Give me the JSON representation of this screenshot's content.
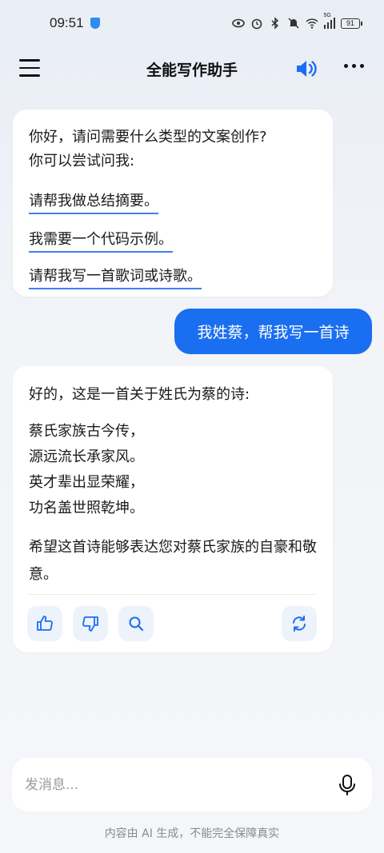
{
  "status": {
    "time": "09:51",
    "signal": "5G",
    "battery": "91"
  },
  "header": {
    "title": "全能写作助手",
    "menu_icon": "hamburger-menu-icon",
    "speaker_icon": "speaker-icon",
    "more_icon": "more-dots-icon",
    "accent": "#1a6ef0"
  },
  "messages": {
    "assistant_intro": {
      "line1": "你好，请问需要什么类型的文案创作?",
      "line2": "你可以尝试问我:",
      "suggestions": [
        "请帮我做总结摘要。",
        "我需要一个代码示例。",
        "请帮我写一首歌词或诗歌。"
      ]
    },
    "user_message": "我姓蔡，帮我写一首诗",
    "assistant_reply": {
      "intro": "好的，这是一首关于姓氏为蔡的诗:",
      "poem": [
        "蔡氏家族古今传，",
        "源远流长承家风。",
        "英才辈出显荣耀，",
        "功名盖世照乾坤。"
      ],
      "outro": "希望这首诗能够表达您对蔡氏家族的自豪和敬意。",
      "actions": [
        "thumbs-up-icon",
        "thumbs-down-icon",
        "search-icon",
        "refresh-icon"
      ]
    }
  },
  "composer": {
    "placeholder": "发消息...",
    "mic_icon": "microphone-icon"
  },
  "footer": {
    "disclaimer": "内容由 AI 生成，不能完全保障真实"
  }
}
